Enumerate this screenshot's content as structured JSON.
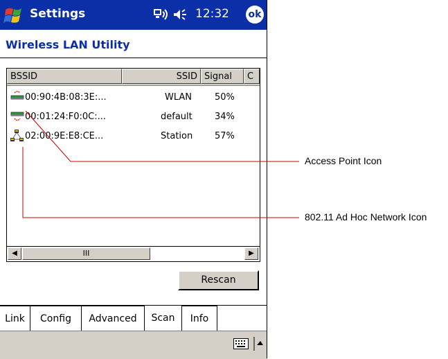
{
  "titlebar": {
    "title": "Settings",
    "time": "12:32",
    "ok_label": "ok"
  },
  "subtitle": "Wireless LAN Utility",
  "list": {
    "columns": [
      "BSSID",
      "SSID",
      "Signal",
      "C"
    ],
    "rows": [
      {
        "bssid": "00:90:4B:08:3E:...",
        "ssid": "WLAN",
        "signal": "50%",
        "icon": "access-point-icon"
      },
      {
        "bssid": "00:01:24:F0:0C:...",
        "ssid": "default",
        "signal": "34%",
        "icon": "access-point-icon"
      },
      {
        "bssid": "02:00:9E:E8:CE...",
        "ssid": "Station",
        "signal": "57%",
        "icon": "adhoc-network-icon"
      }
    ]
  },
  "scrollbar": {
    "thumb_label": "III"
  },
  "rescan_label": "Rescan",
  "tabs": [
    "Link",
    "Config",
    "Advanced",
    "Scan",
    "Info"
  ],
  "active_tab": "Scan",
  "callouts": {
    "access_point": "Access Point Icon",
    "adhoc": "802.11 Ad Hoc Network Icon"
  },
  "colors": {
    "titlebar": "#0a2fa6",
    "callout_line": "#cc0000",
    "chrome": "#d4d0c8"
  }
}
